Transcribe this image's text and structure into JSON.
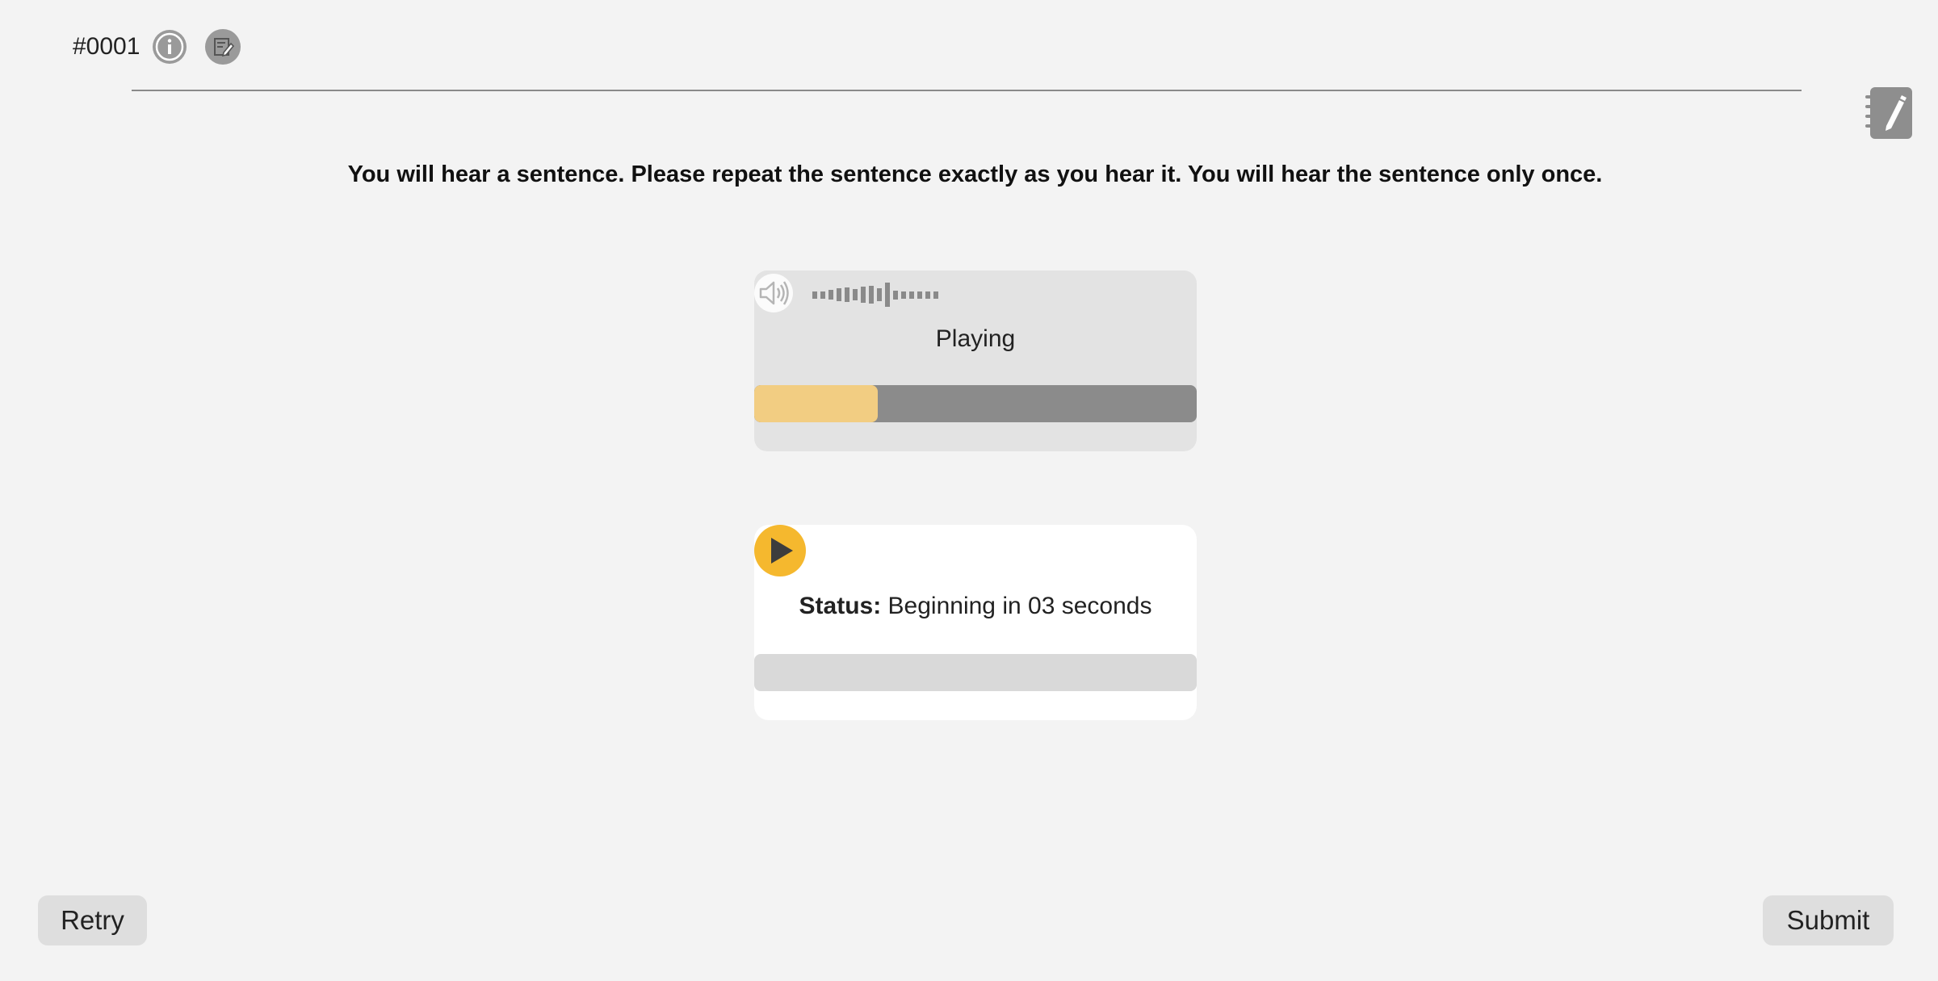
{
  "header": {
    "question_id": "#0001",
    "info_icon": "info-circle-icon",
    "notes_icon": "edit-note-icon"
  },
  "notebook": {
    "icon": "notebook-pencil-icon"
  },
  "instruction": "You will hear a sentence. Please repeat the sentence exactly as you hear it. You will hear the sentence only once.",
  "audio_player": {
    "icon": "speaker-icon",
    "status": "Playing",
    "progress": 0.28,
    "colors": {
      "fill": "#f2cd82",
      "track": "#8b8b8b"
    }
  },
  "recorder": {
    "icon": "play-icon",
    "status_label": "Status:",
    "status_text": "Beginning in 03 seconds",
    "progress": 0,
    "colors": {
      "accent": "#f5b82e",
      "track": "#d9d9d9"
    }
  },
  "footer": {
    "retry_label": "Retry",
    "submit_label": "Submit"
  }
}
